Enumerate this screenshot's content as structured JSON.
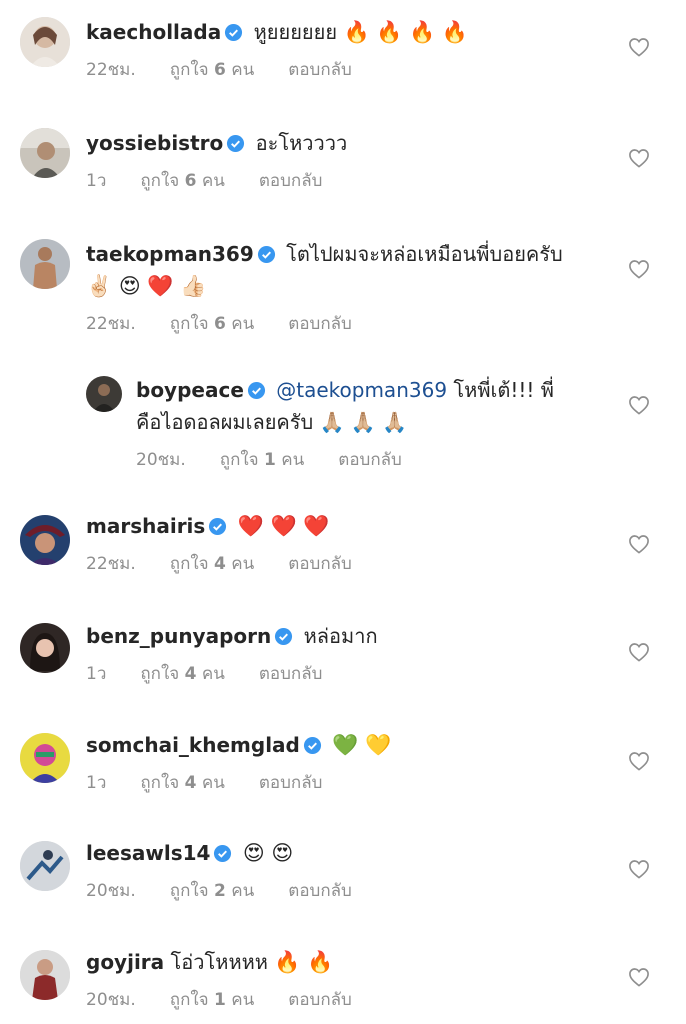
{
  "comments": [
    {
      "username": "kaechollada",
      "text": "หูยยยยยย",
      "emoji": "🔥 🔥 🔥 🔥",
      "time": "22ชม.",
      "likes_prefix": "ถูกใจ",
      "likes": "6",
      "likes_suffix": "คน",
      "reply": "ตอบกลับ",
      "avatar": "avatar-woman",
      "avatar_color": "#d9cfc4"
    },
    {
      "username": "yossiebistro",
      "text": "อะโหวววว",
      "emoji": "",
      "time": "1ว",
      "likes_prefix": "ถูกใจ",
      "likes": "6",
      "likes_suffix": "คน",
      "reply": "ตอบกลับ",
      "avatar": "avatar-man-outdoor",
      "avatar_color": "#b9b2a6"
    },
    {
      "username": "taekopman369",
      "text": "โตไปผมจะหล่อเหมือนพี่บอยครับ",
      "text2": "✌🏻 😍 ❤️ 👍🏻",
      "time": "22ชม.",
      "likes_prefix": "ถูกใจ",
      "likes": "6",
      "likes_suffix": "คน",
      "reply": "ตอบกลับ",
      "avatar": "avatar-shirtless",
      "avatar_color": "#9da3a8"
    },
    {
      "username": "boypeace",
      "mention": "@taekopman369",
      "text": "โหพี่เต้!!! พี่",
      "text2": "คือไอดอลผมเลยครับ 🙏🏼 🙏🏼 🙏🏼",
      "time": "20ชม.",
      "likes_prefix": "ถูกใจ",
      "likes": "1",
      "likes_suffix": "คน",
      "reply": "ตอบกลับ",
      "avatar": "avatar-dark",
      "avatar_color": "#4a4a4a"
    },
    {
      "username": "marshairis",
      "text": "",
      "emoji": "❤️ ❤️ ❤️",
      "time": "22ชม.",
      "likes_prefix": "ถูกใจ",
      "likes": "4",
      "likes_suffix": "คน",
      "reply": "ตอบกลับ",
      "avatar": "avatar-hat-woman",
      "avatar_color": "#2a3f66"
    },
    {
      "username": "benz_punyaporn",
      "text": "หล่อมาก",
      "emoji": "",
      "time": "1ว",
      "likes_prefix": "ถูกใจ",
      "likes": "4",
      "likes_suffix": "คน",
      "reply": "ตอบกลับ",
      "avatar": "avatar-portrait",
      "avatar_color": "#3a2f2c"
    },
    {
      "username": "somchai_khemglad",
      "text": "",
      "emoji": "💚 💛",
      "time": "1ว",
      "likes_prefix": "ถูกใจ",
      "likes": "4",
      "likes_suffix": "คน",
      "reply": "ตอบกลับ",
      "avatar": "avatar-illustration",
      "avatar_color": "#e6d94a"
    },
    {
      "username": "leesawls14",
      "text": "",
      "emoji": "😍 😍",
      "time": "20ชม.",
      "likes_prefix": "ถูกใจ",
      "likes": "2",
      "likes_suffix": "คน",
      "reply": "ตอบกลับ",
      "avatar": "avatar-sports",
      "avatar_color": "#c9cdd2"
    },
    {
      "username": "goyjira",
      "text": "โอ่วโหหหห",
      "emoji": "🔥 🔥",
      "time": "20ชม.",
      "likes_prefix": "ถูกใจ",
      "likes": "1",
      "likes_suffix": "คน",
      "reply": "ตอบกลับ",
      "avatar": "avatar-woman-red",
      "avatar_color": "#7a3b3b"
    }
  ],
  "colors": {
    "verified": "#3897f0",
    "meta": "#8e8e8e",
    "text": "#262626",
    "mention": "#1d4f91"
  }
}
